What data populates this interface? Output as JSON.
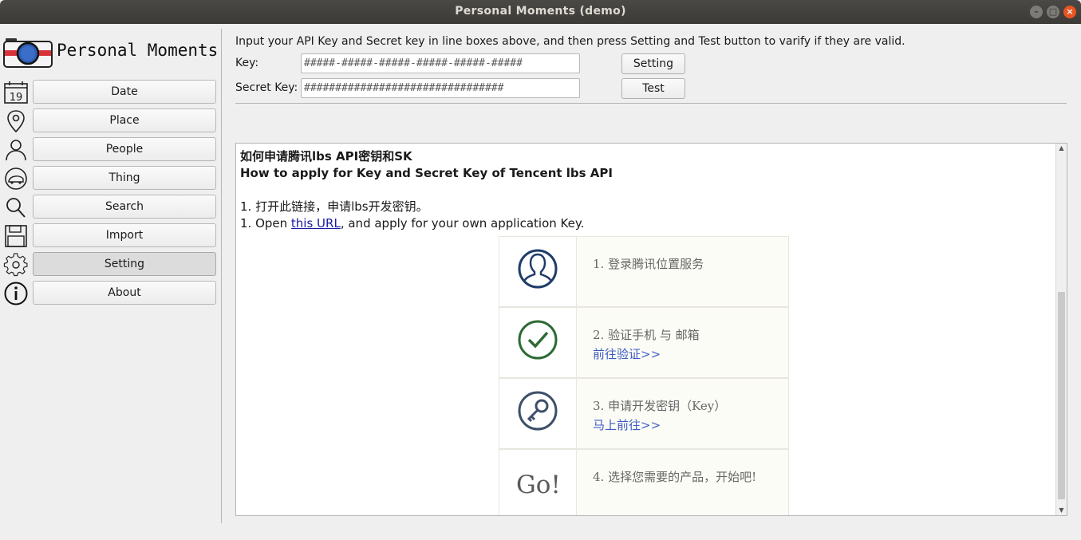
{
  "window": {
    "title": "Personal Moments (demo)"
  },
  "app": {
    "name": "Personal Moments"
  },
  "sidebar": {
    "items": [
      {
        "label": "Date",
        "icon": "calendar-icon",
        "icon_text": "19"
      },
      {
        "label": "Place",
        "icon": "map-pin-icon"
      },
      {
        "label": "People",
        "icon": "person-icon"
      },
      {
        "label": "Thing",
        "icon": "thing-icon"
      },
      {
        "label": "Search",
        "icon": "search-icon"
      },
      {
        "label": "Import",
        "icon": "floppy-disk-icon"
      },
      {
        "label": "Setting",
        "icon": "gear-icon",
        "active": true
      },
      {
        "label": "About",
        "icon": "info-icon"
      }
    ]
  },
  "settings": {
    "instructions": "Input your API Key and Secret key in line boxes above, and then press Setting and Test button to varify if they are valid.",
    "key_label": "Key:",
    "key_value": "#####-#####-#####-#####-#####-#####",
    "secret_label": "Secret Key:",
    "secret_value": "################################",
    "setting_button": "Setting",
    "test_button": "Test"
  },
  "doc": {
    "heading_cn": "如何申请腾讯lbs API密钥和SK",
    "heading_en": "How to apply for Key and Secret Key of Tencent lbs API",
    "step1_cn": "1. 打开此链接，申请lbs开发密钥。",
    "step1_en_prefix": "1. Open ",
    "step1_en_link": "this URL",
    "step1_en_suffix": ", and apply for your own application Key.",
    "steps": [
      {
        "text": "1. 登录腾讯位置服务",
        "link": "",
        "icon": "user-circle-icon"
      },
      {
        "text": "2. 验证手机 与 邮箱",
        "link": "前往验证>>",
        "icon": "check-circle-icon"
      },
      {
        "text": "3. 申请开发密钥（Key）",
        "link": "马上前往>>",
        "icon": "key-icon"
      },
      {
        "text": "4. 选择您需要的产品，开始吧!",
        "link": "",
        "icon": "go-text",
        "icon_text": "Go!"
      }
    ]
  },
  "colors": {
    "titlebar": "#3b3a37",
    "close": "#e95420",
    "link": "#1a1aa6",
    "steps_link": "#3c5bc4"
  }
}
